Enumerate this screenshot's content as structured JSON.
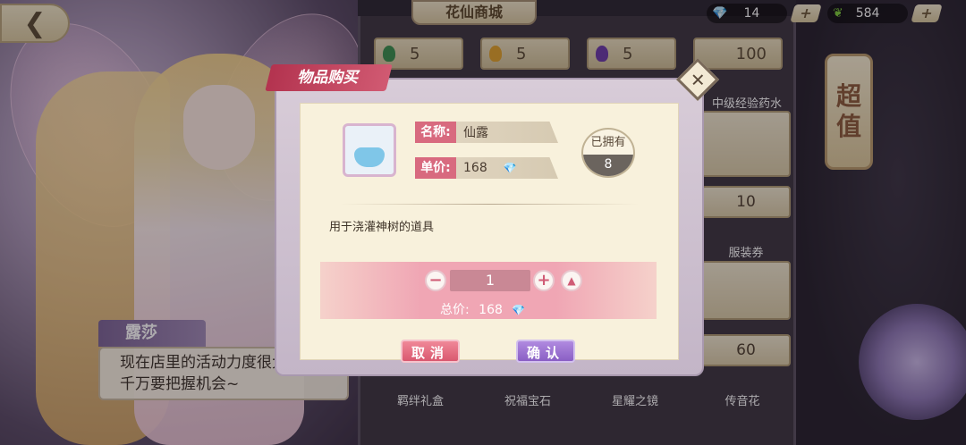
{
  "shop": {
    "title": "花仙商城",
    "currency": [
      {
        "icon": "diamond-icon",
        "value": "14"
      },
      {
        "icon": "leaf-icon",
        "value": "584"
      }
    ],
    "price_slots": [
      "5",
      "5",
      "5",
      "100"
    ],
    "side_tab": [
      "超",
      "值"
    ],
    "item_labels": {
      "col4_row1": "中级经验药水",
      "row2_price": "10",
      "row2_name": "服装券",
      "row3_price": "60",
      "bottom_names": [
        "羁绊礼盒",
        "祝福宝石",
        "星耀之镜",
        "传音花"
      ]
    }
  },
  "npc": {
    "name": "露莎",
    "line1": "现在店里的活动力度很大哦",
    "line2": "千万要把握机会~"
  },
  "modal": {
    "title": "物品购买",
    "name_label": "名称:",
    "name_value": "仙露",
    "price_label": "单价:",
    "price_value": "168",
    "owned_label": "已拥有",
    "owned_value": "8",
    "description": "用于浇灌神树的道具",
    "quantity": "1",
    "total_label": "总价:",
    "total_value": "168",
    "minus": "−",
    "plus": "+",
    "max": "▲",
    "cancel_label": "取消",
    "confirm_label": "确认",
    "close": "✕"
  },
  "colors": {
    "accent_pink": "#d86a7f",
    "cancel": "#d9586f",
    "confirm": "#8a5fc4"
  }
}
